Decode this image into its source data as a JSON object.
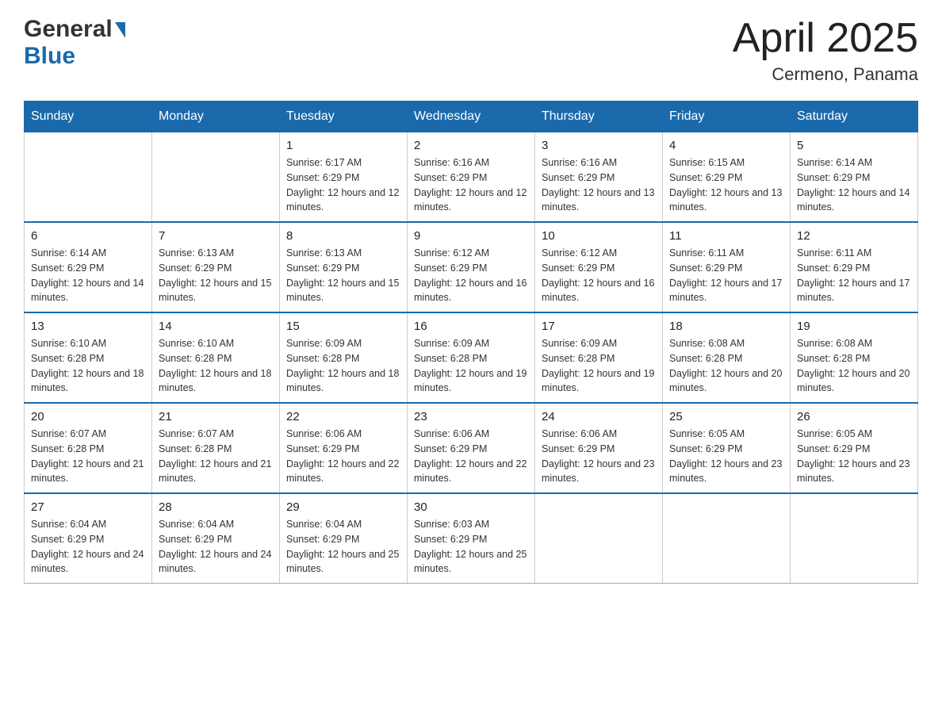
{
  "header": {
    "logo": {
      "general": "General",
      "blue": "Blue"
    },
    "month": "April 2025",
    "location": "Cermeno, Panama"
  },
  "weekdays": [
    "Sunday",
    "Monday",
    "Tuesday",
    "Wednesday",
    "Thursday",
    "Friday",
    "Saturday"
  ],
  "weeks": [
    [
      {
        "day": "",
        "sunrise": "",
        "sunset": "",
        "daylight": ""
      },
      {
        "day": "",
        "sunrise": "",
        "sunset": "",
        "daylight": ""
      },
      {
        "day": "1",
        "sunrise": "Sunrise: 6:17 AM",
        "sunset": "Sunset: 6:29 PM",
        "daylight": "Daylight: 12 hours and 12 minutes."
      },
      {
        "day": "2",
        "sunrise": "Sunrise: 6:16 AM",
        "sunset": "Sunset: 6:29 PM",
        "daylight": "Daylight: 12 hours and 12 minutes."
      },
      {
        "day": "3",
        "sunrise": "Sunrise: 6:16 AM",
        "sunset": "Sunset: 6:29 PM",
        "daylight": "Daylight: 12 hours and 13 minutes."
      },
      {
        "day": "4",
        "sunrise": "Sunrise: 6:15 AM",
        "sunset": "Sunset: 6:29 PM",
        "daylight": "Daylight: 12 hours and 13 minutes."
      },
      {
        "day": "5",
        "sunrise": "Sunrise: 6:14 AM",
        "sunset": "Sunset: 6:29 PM",
        "daylight": "Daylight: 12 hours and 14 minutes."
      }
    ],
    [
      {
        "day": "6",
        "sunrise": "Sunrise: 6:14 AM",
        "sunset": "Sunset: 6:29 PM",
        "daylight": "Daylight: 12 hours and 14 minutes."
      },
      {
        "day": "7",
        "sunrise": "Sunrise: 6:13 AM",
        "sunset": "Sunset: 6:29 PM",
        "daylight": "Daylight: 12 hours and 15 minutes."
      },
      {
        "day": "8",
        "sunrise": "Sunrise: 6:13 AM",
        "sunset": "Sunset: 6:29 PM",
        "daylight": "Daylight: 12 hours and 15 minutes."
      },
      {
        "day": "9",
        "sunrise": "Sunrise: 6:12 AM",
        "sunset": "Sunset: 6:29 PM",
        "daylight": "Daylight: 12 hours and 16 minutes."
      },
      {
        "day": "10",
        "sunrise": "Sunrise: 6:12 AM",
        "sunset": "Sunset: 6:29 PM",
        "daylight": "Daylight: 12 hours and 16 minutes."
      },
      {
        "day": "11",
        "sunrise": "Sunrise: 6:11 AM",
        "sunset": "Sunset: 6:29 PM",
        "daylight": "Daylight: 12 hours and 17 minutes."
      },
      {
        "day": "12",
        "sunrise": "Sunrise: 6:11 AM",
        "sunset": "Sunset: 6:29 PM",
        "daylight": "Daylight: 12 hours and 17 minutes."
      }
    ],
    [
      {
        "day": "13",
        "sunrise": "Sunrise: 6:10 AM",
        "sunset": "Sunset: 6:28 PM",
        "daylight": "Daylight: 12 hours and 18 minutes."
      },
      {
        "day": "14",
        "sunrise": "Sunrise: 6:10 AM",
        "sunset": "Sunset: 6:28 PM",
        "daylight": "Daylight: 12 hours and 18 minutes."
      },
      {
        "day": "15",
        "sunrise": "Sunrise: 6:09 AM",
        "sunset": "Sunset: 6:28 PM",
        "daylight": "Daylight: 12 hours and 18 minutes."
      },
      {
        "day": "16",
        "sunrise": "Sunrise: 6:09 AM",
        "sunset": "Sunset: 6:28 PM",
        "daylight": "Daylight: 12 hours and 19 minutes."
      },
      {
        "day": "17",
        "sunrise": "Sunrise: 6:09 AM",
        "sunset": "Sunset: 6:28 PM",
        "daylight": "Daylight: 12 hours and 19 minutes."
      },
      {
        "day": "18",
        "sunrise": "Sunrise: 6:08 AM",
        "sunset": "Sunset: 6:28 PM",
        "daylight": "Daylight: 12 hours and 20 minutes."
      },
      {
        "day": "19",
        "sunrise": "Sunrise: 6:08 AM",
        "sunset": "Sunset: 6:28 PM",
        "daylight": "Daylight: 12 hours and 20 minutes."
      }
    ],
    [
      {
        "day": "20",
        "sunrise": "Sunrise: 6:07 AM",
        "sunset": "Sunset: 6:28 PM",
        "daylight": "Daylight: 12 hours and 21 minutes."
      },
      {
        "day": "21",
        "sunrise": "Sunrise: 6:07 AM",
        "sunset": "Sunset: 6:28 PM",
        "daylight": "Daylight: 12 hours and 21 minutes."
      },
      {
        "day": "22",
        "sunrise": "Sunrise: 6:06 AM",
        "sunset": "Sunset: 6:29 PM",
        "daylight": "Daylight: 12 hours and 22 minutes."
      },
      {
        "day": "23",
        "sunrise": "Sunrise: 6:06 AM",
        "sunset": "Sunset: 6:29 PM",
        "daylight": "Daylight: 12 hours and 22 minutes."
      },
      {
        "day": "24",
        "sunrise": "Sunrise: 6:06 AM",
        "sunset": "Sunset: 6:29 PM",
        "daylight": "Daylight: 12 hours and 23 minutes."
      },
      {
        "day": "25",
        "sunrise": "Sunrise: 6:05 AM",
        "sunset": "Sunset: 6:29 PM",
        "daylight": "Daylight: 12 hours and 23 minutes."
      },
      {
        "day": "26",
        "sunrise": "Sunrise: 6:05 AM",
        "sunset": "Sunset: 6:29 PM",
        "daylight": "Daylight: 12 hours and 23 minutes."
      }
    ],
    [
      {
        "day": "27",
        "sunrise": "Sunrise: 6:04 AM",
        "sunset": "Sunset: 6:29 PM",
        "daylight": "Daylight: 12 hours and 24 minutes."
      },
      {
        "day": "28",
        "sunrise": "Sunrise: 6:04 AM",
        "sunset": "Sunset: 6:29 PM",
        "daylight": "Daylight: 12 hours and 24 minutes."
      },
      {
        "day": "29",
        "sunrise": "Sunrise: 6:04 AM",
        "sunset": "Sunset: 6:29 PM",
        "daylight": "Daylight: 12 hours and 25 minutes."
      },
      {
        "day": "30",
        "sunrise": "Sunrise: 6:03 AM",
        "sunset": "Sunset: 6:29 PM",
        "daylight": "Daylight: 12 hours and 25 minutes."
      },
      {
        "day": "",
        "sunrise": "",
        "sunset": "",
        "daylight": ""
      },
      {
        "day": "",
        "sunrise": "",
        "sunset": "",
        "daylight": ""
      },
      {
        "day": "",
        "sunrise": "",
        "sunset": "",
        "daylight": ""
      }
    ]
  ]
}
